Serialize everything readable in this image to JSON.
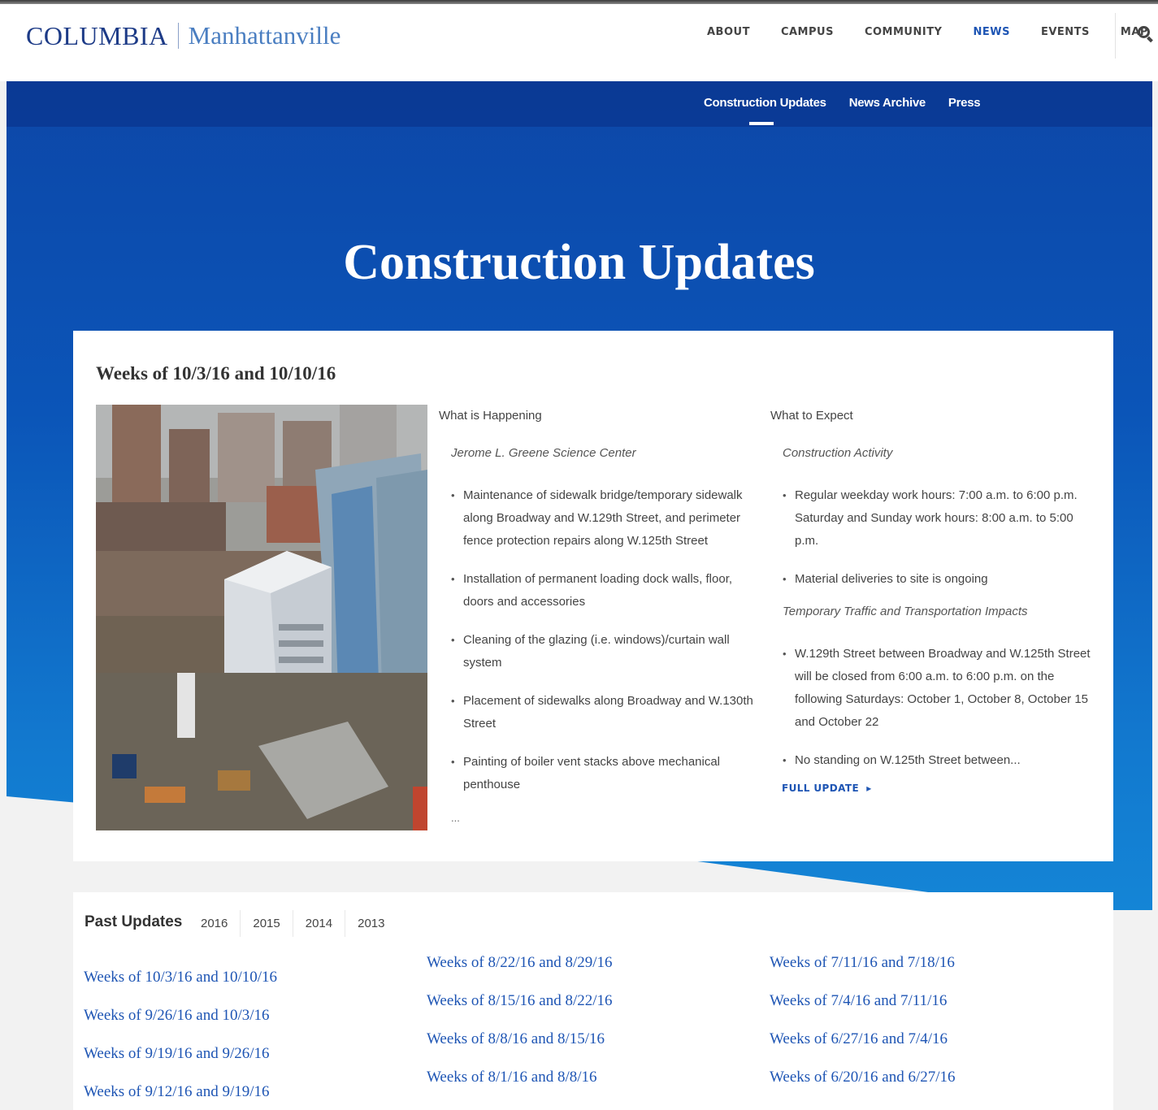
{
  "header": {
    "brand": "COLUMBIA",
    "site": "Manhattanville",
    "nav": [
      "ABOUT",
      "CAMPUS",
      "COMMUNITY",
      "NEWS",
      "EVENTS",
      "MAP"
    ]
  },
  "subnav": [
    "Construction Updates",
    "News Archive",
    "Press"
  ],
  "hero": {
    "title": "Construction Updates"
  },
  "update": {
    "title": "Weeks of 10/3/16 and 10/10/16",
    "happening": {
      "heading": "What is Happening",
      "subheading": "Jerome L. Greene Science Center",
      "items": [
        "Maintenance of sidewalk bridge/temporary sidewalk along Broadway and W.129th Street, and perimeter fence protection repairs along W.125th Street",
        "Installation of permanent loading dock walls, floor, doors and accessories",
        "Cleaning of the glazing (i.e. windows)/curtain wall system",
        "Placement of sidewalks along Broadway and W.130th Street",
        "Painting of boiler vent stacks above mechanical penthouse"
      ],
      "ellipsis": "..."
    },
    "expect": {
      "heading": "What to Expect",
      "subheading": "Construction Activity",
      "items": [
        "Regular weekday work hours: 7:00 a.m. to 6:00 p.m. Saturday and Sunday work hours: 8:00 a.m. to 5:00 p.m.",
        "Material deliveries to site is ongoing"
      ],
      "subheading2": "Temporary Traffic and Transportation Impacts",
      "items2": [
        "W.129th Street between Broadway and W.125th Street will be closed from 6:00 a.m. to 6:00 p.m. on the following Saturdays: October 1, October 8, October 15 and October 22",
        "No standing on W.125th Street between..."
      ]
    },
    "full_update": "FULL UPDATE"
  },
  "past": {
    "title": "Past Updates",
    "years": [
      "2016",
      "2015",
      "2014",
      "2013"
    ],
    "col1": [
      "Weeks of 10/3/16 and 10/10/16",
      "Weeks of 9/26/16 and 10/3/16",
      "Weeks of 9/19/16 and 9/26/16",
      "Weeks of 9/12/16 and 9/19/16"
    ],
    "col2": [
      "Weeks of 8/22/16 and 8/29/16",
      "Weeks of 8/15/16 and 8/22/16",
      "Weeks of 8/8/16 and 8/15/16",
      "Weeks of 8/1/16 and 8/8/16"
    ],
    "col3": [
      "Weeks of 7/11/16 and 7/18/16",
      "Weeks of 7/4/16 and 7/11/16",
      "Weeks of 6/27/16 and 7/4/16",
      "Weeks of 6/20/16 and 6/27/16"
    ]
  },
  "icons": {
    "search": "search-icon",
    "arrow": "caret-right-icon"
  },
  "colors": {
    "brand_blue": "#1d3b87",
    "link_blue": "#1e55b4",
    "hero_blue": "#0b55b8"
  }
}
